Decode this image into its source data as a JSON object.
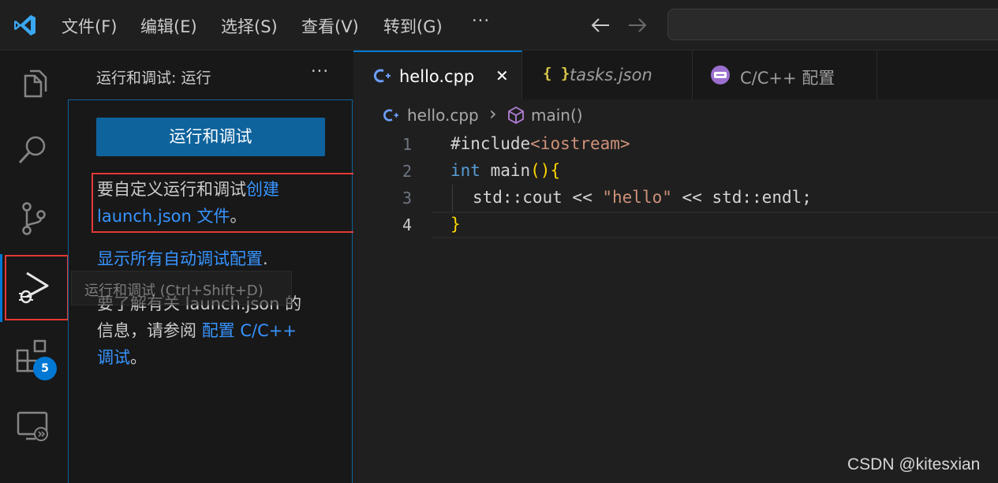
{
  "titlebar": {
    "menu": [
      "文件(F)",
      "编辑(E)",
      "选择(S)",
      "查看(V)",
      "转到(G)"
    ],
    "more": "···",
    "back_icon": "arrow-left-icon",
    "forward_icon": "arrow-right-icon"
  },
  "activitybar": {
    "items": [
      "explorer-icon",
      "search-icon",
      "source-control-icon",
      "run-debug-icon",
      "extensions-icon",
      "remote-explorer-icon"
    ],
    "extensions_badge": "5",
    "tooltip": "运行和调试 (Ctrl+Shift+D)"
  },
  "sidebar": {
    "title": "运行和调试: 运行",
    "more": "···",
    "run_button": "运行和调试",
    "customize_text": "要自定义运行和调试",
    "create_link": "创建",
    "launch_link": "launch.json 文件",
    "period": "。",
    "show_all_link": "显示所有自动调试配置",
    "show_all_period": ".",
    "learn_text_1": "要了解有关 launch.json 的",
    "learn_text_2": "信息，请参阅 ",
    "config_link": "配置 C/C++",
    "debug_link": "调试",
    "end_period": "。"
  },
  "tabs": [
    {
      "label": "hello.cpp",
      "active": true,
      "icon": "cpp-icon",
      "close": "✕"
    },
    {
      "label": "tasks.json",
      "active": false,
      "icon": "json-icon",
      "icon_text": "{ }"
    },
    {
      "label": "C/C++ 配置",
      "active": false,
      "icon": "cpp-config-icon"
    }
  ],
  "breadcrumb": {
    "file": "hello.cpp",
    "separator": "›",
    "symbol": "main()"
  },
  "code": {
    "line_numbers": [
      "1",
      "2",
      "3",
      "4"
    ],
    "l1": {
      "pp": "#include",
      "inc": "<iostream>"
    },
    "l2": {
      "kw": "int",
      "fn": " main",
      "paren": "()",
      "brace": "{"
    },
    "l3": {
      "a": "std::cout << ",
      "str": "\"hello\"",
      "b": " << std::endl;"
    },
    "l4": {
      "brace": "}"
    }
  },
  "watermark": "CSDN @kitesxian",
  "colors": {
    "accent": "#0e639c",
    "link": "#3794ff",
    "highlight": "#e53935",
    "badge": "#0078d4"
  }
}
